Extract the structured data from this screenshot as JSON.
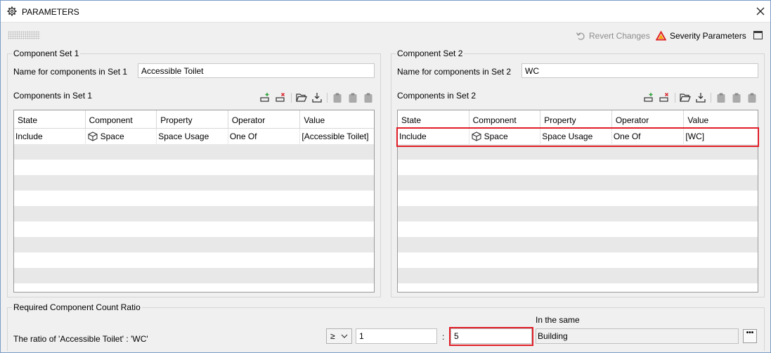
{
  "window": {
    "title": "PARAMETERS"
  },
  "toolbar": {
    "revert_label": "Revert Changes",
    "severity_label": "Severity Parameters"
  },
  "set1": {
    "legend": "Component Set 1",
    "name_label": "Name for components in Set 1",
    "name_value": "Accessible Toilet",
    "components_label": "Components in Set 1",
    "columns": [
      "State",
      "Component",
      "Property",
      "Operator",
      "Value"
    ],
    "rows": [
      {
        "state": "Include",
        "component": "Space",
        "property": "Space Usage",
        "operator": "One Of",
        "value": "[Accessible Toilet]"
      }
    ]
  },
  "set2": {
    "legend": "Component Set 2",
    "name_label": "Name for components in Set 2",
    "name_value": "WC",
    "components_label": "Components in Set 2",
    "columns": [
      "State",
      "Component",
      "Property",
      "Operator",
      "Value"
    ],
    "rows": [
      {
        "state": "Include",
        "component": "Space",
        "property": "Space Usage",
        "operator": "One Of",
        "value": "[WC]"
      }
    ]
  },
  "ratio": {
    "legend": "Required Component Count Ratio",
    "label": "The ratio of 'Accessible Toilet' : 'WC'",
    "operator": "≥",
    "left_value": "1",
    "colon": ":",
    "right_value": "5",
    "same_label": "In the same",
    "scope_value": "Building",
    "browse_label": "•••"
  },
  "colors": {
    "highlight": "#e01d26",
    "add": "#2fa33a",
    "remove": "#d9262c"
  },
  "icons": [
    "gear-icon",
    "close-icon",
    "revert-icon",
    "warning-triangle-icon",
    "panel-layout-icon",
    "add-row-icon",
    "remove-row-icon",
    "open-folder-icon",
    "download-icon",
    "clipboard-icon",
    "cube-icon",
    "chevron-down-icon"
  ]
}
